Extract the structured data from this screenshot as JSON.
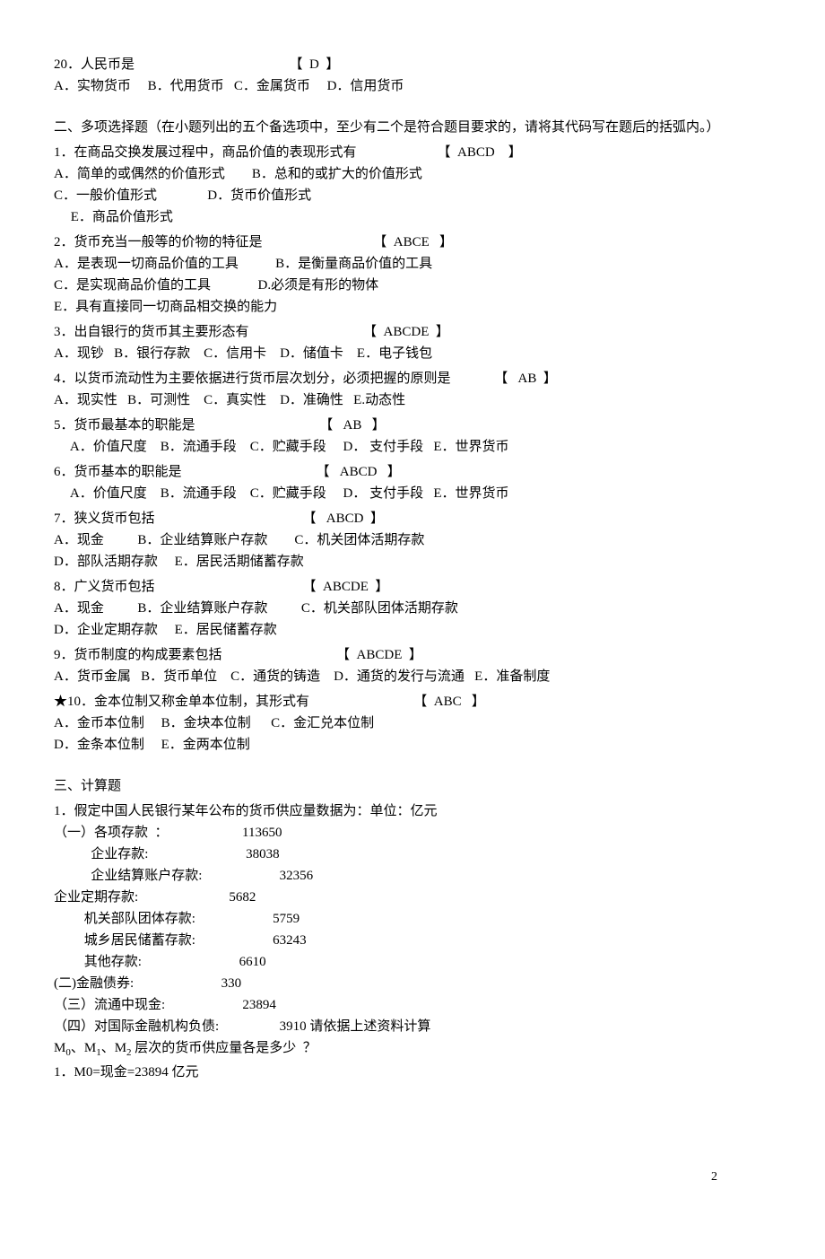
{
  "q20": {
    "line1_left": "20．人民币是",
    "line1_right": "【  D  】",
    "opts": "A．实物货币     B．代用货币   C．金属货币     D．信用货币"
  },
  "section2_title": "二、多项选择题（在小题列出的五个备选项中，至少有二个是符合题目要求的，请将其代码写在题后的括弧内。）",
  "mq1": {
    "stem_left": "1．在商品交换发展过程中，商品价值的表现形式有",
    "stem_right": "【  ABCD    】",
    "l2": "A．简单的或偶然的价值形式        B．总和的或扩大的价值形式",
    "l3": "C．一般价值形式               D．货币价值形式",
    "l4": "     E．商品价值形式"
  },
  "mq2": {
    "stem_left": "2．货币充当一般等的价物的特征是",
    "stem_right": "【  ABCE   】",
    "l2": "A．是表现一切商品价值的工具           B．是衡量商品价值的工具",
    "l3": "C．是实现商品价值的工具              D.必须是有形的物体",
    "l4": "E．具有直接同一切商品相交换的能力"
  },
  "mq3": {
    "stem_left": "3．出自银行的货币其主要形态有",
    "stem_right": "【  ABCDE  】",
    "l2": "A．现钞   B．银行存款    C．信用卡    D．储值卡    E．电子钱包"
  },
  "mq4": {
    "stem_left": "4．以货币流动性为主要依据进行货币层次划分，必须把握的原则是",
    "stem_right": "【   AB  】",
    "l2": "A．现实性   B．可测性    C．真实性    D．准确性   E.动态性"
  },
  "mq5": {
    "stem_left": "5．货币最基本的职能是",
    "stem_right": "【   AB   】",
    "l2": "     A．价值尺度    B．流通手段    C．贮藏手段     D． 支付手段   E．世界货币"
  },
  "mq6": {
    "stem_left": "6．货币基本的职能是",
    "stem_right": "【   ABCD   】",
    "l2": "     A．价值尺度    B．流通手段    C．贮藏手段     D． 支付手段   E．世界货币"
  },
  "mq7": {
    "stem_left": "7．狭义货币包括",
    "stem_right": "【   ABCD  】",
    "l2": "A．现金          B．企业结算账户存款        C．机关团体活期存款",
    "l3": "D．部队活期存款     E．居民活期储蓄存款"
  },
  "mq8": {
    "stem_left": "8．广义货币包括",
    "stem_right": "【  ABCDE  】",
    "l2": "A．现金          B．企业结算账户存款          C．机关部队团体活期存款",
    "l3": "D．企业定期存款     E．居民储蓄存款"
  },
  "mq9": {
    "stem_left": "9．货币制度的构成要素包括",
    "stem_right": "【  ABCDE  】",
    "l2": "A．货币金属   B．货币单位    C．通货的铸造    D．通货的发行与流通   E．准备制度"
  },
  "mq10": {
    "stem_left": "★10．金本位制又称金单本位制，其形式有",
    "stem_right": "【  ABC   】",
    "l2": "A．金币本位制     B．金块本位制      C．金汇兑本位制",
    "l3": "D．金条本位制     E．金两本位制"
  },
  "section3_title": "三、计算题",
  "calc": {
    "l1": "1．假定中国人民银行某年公布的货币供应量数据为：单位：亿元",
    "l2": "（一）各项存款  ：                      113650",
    "l3": "           企业存款:                             38038",
    "l4": "           企业结算账户存款:                       32356",
    "l5": "企业定期存款:                           5682",
    "l6": "         机关部队团体存款:                       5759",
    "l7": "         城乡居民储蓄存款:                       63243",
    "l8": "         其他存款:                             6610",
    "l9": "(二)金融债券:                          330",
    "l10": "（三）流通中现金:                       23894",
    "l11": "（四）对国际金融机构负债:                  3910 请依据上述资料计算",
    "l12_prefix": "M",
    "l12_mid1": "、M",
    "l12_mid2": "、M",
    "l12_suffix": " 层次的货币供应量各是多少  ？",
    "sub0": "0",
    "sub1": "1",
    "sub2": "2",
    "l13": "1．M0=现金=23894 亿元"
  },
  "page_number": "2"
}
